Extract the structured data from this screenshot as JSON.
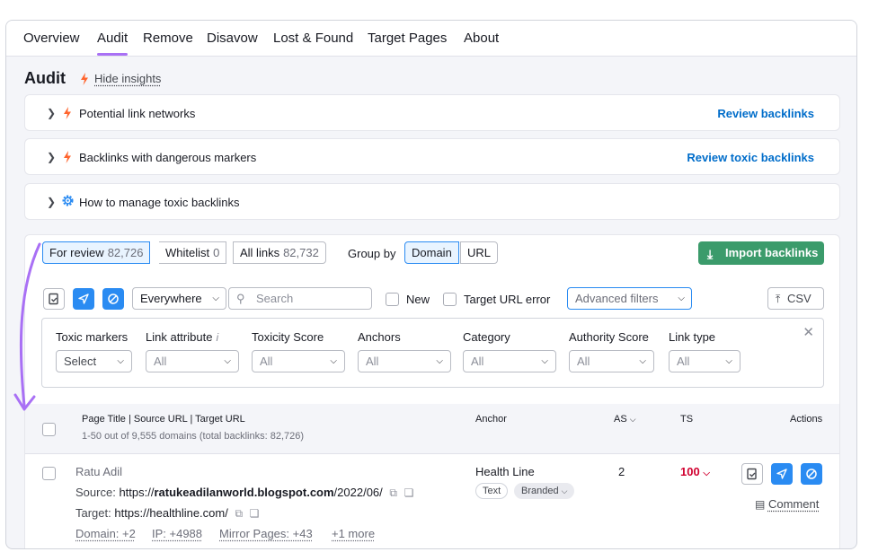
{
  "nav": {
    "tabs": [
      "Overview",
      "Audit",
      "Remove",
      "Disavow",
      "Lost & Found",
      "Target Pages",
      "About"
    ],
    "active": "Audit"
  },
  "audit": {
    "title": "Audit",
    "hide_insights": "Hide insights",
    "insights": [
      {
        "label": "Potential link networks",
        "icon": "bolt-icon",
        "link": "Review backlinks"
      },
      {
        "label": "Backlinks with dangerous markers",
        "icon": "bolt-icon",
        "link": "Review toxic backlinks"
      },
      {
        "label": "How to manage toxic backlinks",
        "icon": "gear-icon",
        "link": ""
      }
    ]
  },
  "toolbar": {
    "segments": [
      {
        "label": "For review",
        "count": "82,726"
      },
      {
        "label": "Whitelist",
        "count": "0"
      },
      {
        "label": "All links",
        "count": "82,732"
      }
    ],
    "group_by_label": "Group by",
    "group_by": [
      "Domain",
      "URL"
    ],
    "group_selected": "Domain",
    "import_label": "Import backlinks",
    "scope": "Everywhere",
    "search_placeholder": "Search",
    "new_label": "New",
    "target_error_label": "Target URL error",
    "advanced_filters": "Advanced filters",
    "csv_label": "CSV"
  },
  "filters": [
    {
      "label": "Toxic markers",
      "value": "Select"
    },
    {
      "label": "Link attribute",
      "value": "All",
      "info": "i"
    },
    {
      "label": "Toxicity Score",
      "value": "All"
    },
    {
      "label": "Anchors",
      "value": "All"
    },
    {
      "label": "Category",
      "value": "All"
    },
    {
      "label": "Authority Score",
      "value": "All"
    },
    {
      "label": "Link type",
      "value": "All"
    }
  ],
  "table": {
    "headers": {
      "page": "Page Title | Source URL | Target URL",
      "anchor": "Anchor",
      "as": "AS",
      "ts": "TS",
      "actions": "Actions"
    },
    "summary": "1-50 out of 9,555 domains (total backlinks: 82,726)",
    "rows": [
      {
        "title": "Ratu Adil",
        "source_label": "Source:",
        "source_prefix": "https://",
        "source_domain": "ratukeadilanworld.blogspot.com",
        "source_path": "/2022/06/",
        "target_label": "Target:",
        "target": "https://healthline.com/",
        "domain": "Domain: +2",
        "ip": "IP: +4988",
        "mirror": "Mirror Pages: +43",
        "more": "+1 more",
        "anchor": "Health Line",
        "tags": [
          "Text",
          "Branded"
        ],
        "as": "2",
        "ts": "100",
        "comment": "Comment"
      }
    ]
  },
  "colors": {
    "accent": "#a970f5",
    "link": "#006dca",
    "bolt": "#ff642d",
    "import": "#3b9b6b",
    "action": "#2a8bf2",
    "toxic": "#d1002f"
  }
}
